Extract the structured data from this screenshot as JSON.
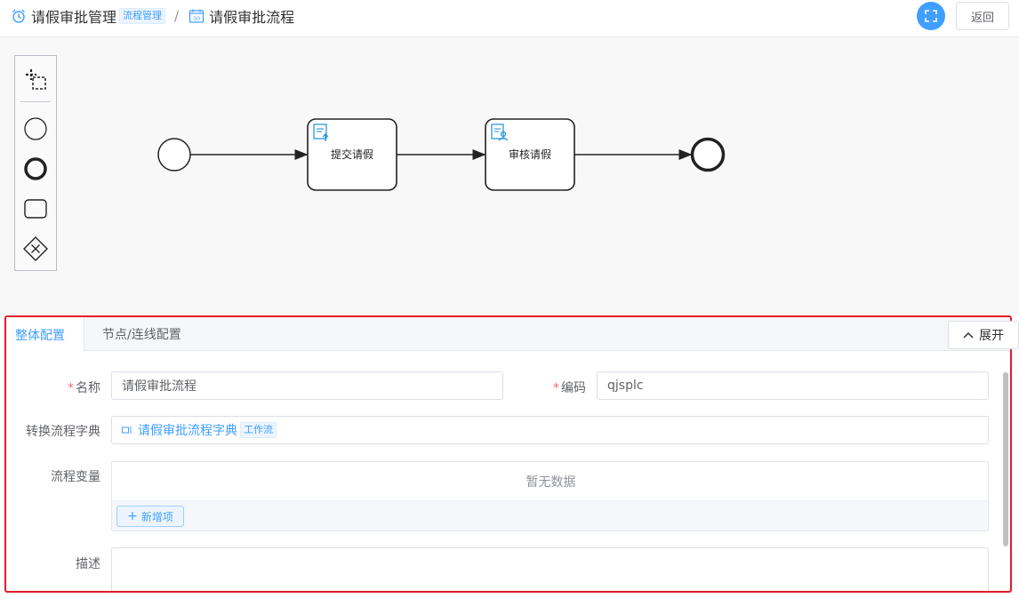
{
  "header": {
    "breadcrumb_root": "请假审批管理",
    "breadcrumb_root_tag": "流程管理",
    "separator": "/",
    "breadcrumb_current": "请假审批流程",
    "calendar_icon_text": "30",
    "back_label": "返回"
  },
  "diagram": {
    "palette": [
      "hand-tool",
      "start-event",
      "end-event",
      "task",
      "gateway"
    ],
    "nodes": [
      {
        "type": "start-event"
      },
      {
        "type": "user-task",
        "label": "提交请假",
        "icon": "submit-form-icon"
      },
      {
        "type": "user-task",
        "label": "审核请假",
        "icon": "review-user-icon"
      },
      {
        "type": "end-event"
      }
    ]
  },
  "panel": {
    "tabs": [
      {
        "label": "整体配置",
        "active": true
      },
      {
        "label": "节点/连线配置",
        "active": false
      }
    ],
    "expand_label": "展开",
    "form": {
      "name_label": "名称",
      "name_value": "请假审批流程",
      "code_label": "编码",
      "code_value": "qjsplc",
      "dict_label": "转换流程字典",
      "dict_value": "请假审批流程字典",
      "dict_tag": "工作流",
      "vars_label": "流程变量",
      "vars_empty": "暂无数据",
      "add_item_label": "新增项",
      "desc_label": "描述"
    }
  },
  "colors": {
    "primary": "#409eff",
    "highlight_border": "#e51b2a",
    "required": "#f56c6c"
  }
}
